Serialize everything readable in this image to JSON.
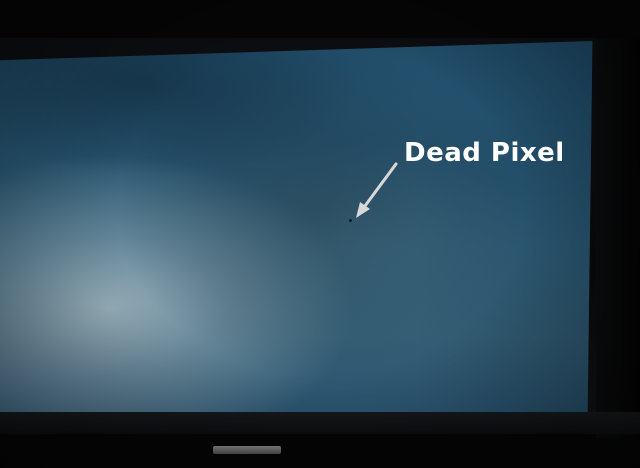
{
  "photo": {
    "subject": "monitor-screen",
    "annotation": {
      "label": "Dead Pixel",
      "label_color": "#ffffff",
      "arrow_color": "#d8d8d8"
    },
    "colors": {
      "screen_top": "#1f4a66",
      "screen_glow": "#aabec6",
      "bezel": "#0b0d10",
      "dead_pixel": "#0d1f2a"
    }
  }
}
